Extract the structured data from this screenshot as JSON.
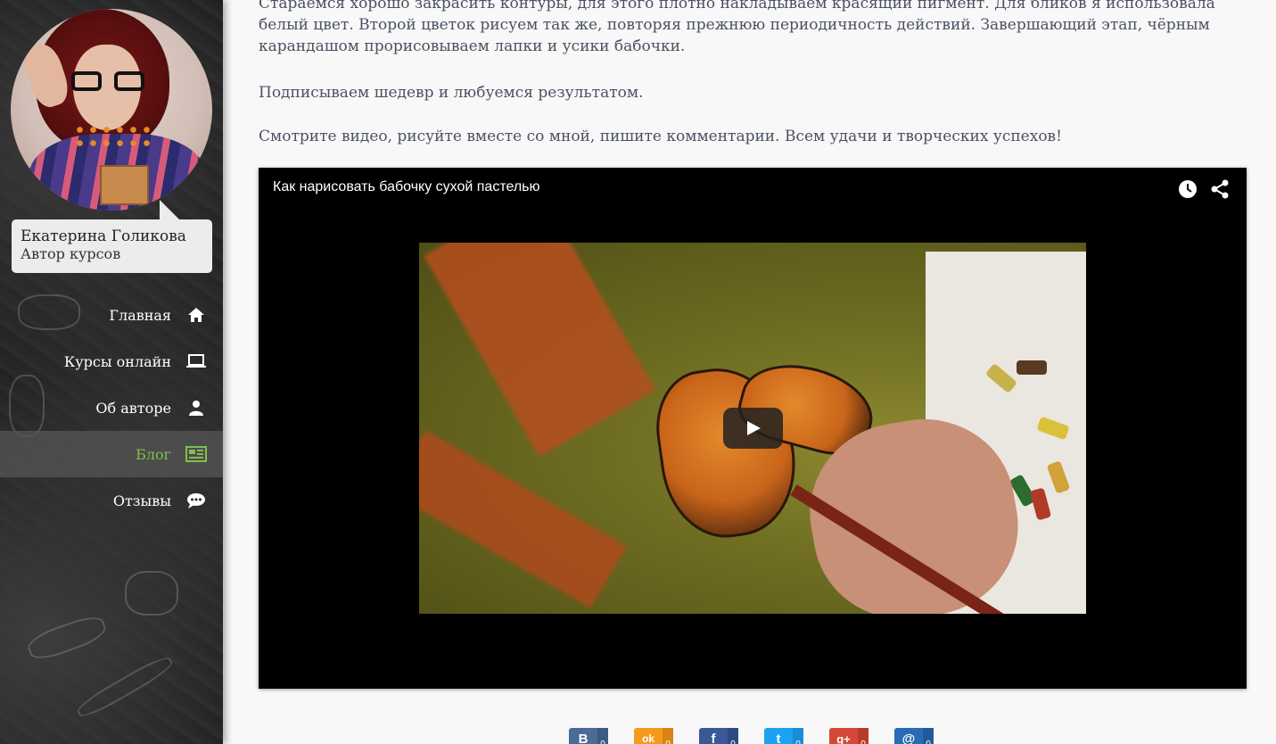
{
  "author": {
    "name": "Екатерина Голикова",
    "role": "Автор курсов"
  },
  "nav": [
    {
      "label": "Главная",
      "icon": "home-icon",
      "active": false
    },
    {
      "label": "Курсы онлайн",
      "icon": "laptop-icon",
      "active": false
    },
    {
      "label": "Об авторе",
      "icon": "user-icon",
      "active": false
    },
    {
      "label": "Блог",
      "icon": "newspaper-icon",
      "active": true
    },
    {
      "label": "Отзывы",
      "icon": "chat-icon",
      "active": false
    }
  ],
  "content": {
    "paragraph1": "Стараемся хорошо закрасить контуры, для этого плотно накладываем красящий пигмент. Для бликов я использовала белый цвет. Второй цветок рисуем так же, повторяя прежнюю периодичность действий. Завершающий этап, чёрным карандашом прорисовываем лапки и усики бабочки.",
    "paragraph2": "Подписываем шедевр и любуемся результатом.",
    "paragraph3": "Смотрите видео, рисуйте вместе со мной, пишите комментарии. Всем удачи и творческих успехов!"
  },
  "video": {
    "title": "Как нарисовать бабочку сухой пастелью",
    "icons": [
      "clock-icon",
      "share-icon",
      "play-icon"
    ]
  },
  "share_buttons": [
    {
      "network": "vk",
      "glyph": "B",
      "count": "0",
      "color": "#4a6b95",
      "dark": "#3d5a7f"
    },
    {
      "network": "odnoklassniki",
      "glyph": "ok",
      "count": "0",
      "color": "#f59a1f",
      "dark": "#d98414"
    },
    {
      "network": "facebook",
      "glyph": "f",
      "count": "0",
      "color": "#3b5998",
      "dark": "#2f4a82"
    },
    {
      "network": "twitter",
      "glyph": "t",
      "count": "0",
      "color": "#1da1f2",
      "dark": "#168ed8"
    },
    {
      "network": "google-plus",
      "glyph": "g+",
      "count": "0",
      "color": "#d34836",
      "dark": "#b83a2b"
    },
    {
      "network": "mail",
      "glyph": "@",
      "count": "0",
      "color": "#2a6cb3",
      "dark": "#215a98"
    }
  ],
  "colors": {
    "active_nav": "#7fc04a",
    "text": "#4a5162"
  }
}
